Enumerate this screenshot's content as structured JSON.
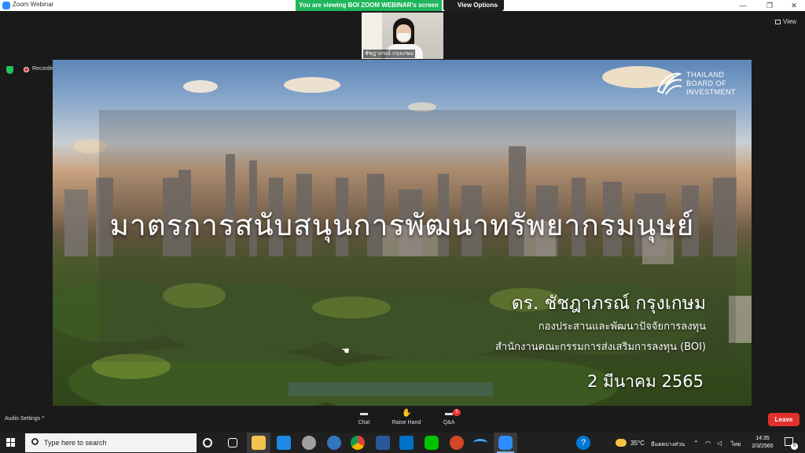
{
  "window": {
    "title": "Zoom Webinar",
    "min": "—",
    "max": "❐",
    "close": "✕"
  },
  "banner": {
    "text": "You are viewing BOI ZOOM WEBINAR's screen"
  },
  "view_options": {
    "label": "View Options",
    "chevron": "⌄"
  },
  "view_button": {
    "label": "View"
  },
  "recording": {
    "label": "Recording"
  },
  "participant": {
    "name": "ชัชฎาภรณ์ กรุงเกษม"
  },
  "slide": {
    "title": "มาตรการสนับสนุนการพัฒนาทรัพยากรมนุษย์",
    "presenter": "ดร. ชัชฎาภรณ์ กรุงเกษม",
    "org_line1": "กองประสานและพัฒนาปัจจัยการลงทุน",
    "org_line2": "สำนักงานคณะกรรมการส่งเสริมการลงทุน (BOI)",
    "date": "2 มีนาคม 2565",
    "logo_line1": "THAILAND",
    "logo_line2": "BOARD OF",
    "logo_line3": "INVESTMENT"
  },
  "toolbar": {
    "audio_settings": "Audio Settings",
    "audio_chevron": "^",
    "chat": "Chat",
    "raise_hand": "Raise Hand",
    "qa": "Q&A",
    "qa_badge": "5",
    "leave": "Leave"
  },
  "taskbar": {
    "search_placeholder": "Type here to search",
    "weather": "35°C",
    "weather_desc": "มีแดดบางส่วน",
    "language": "ไทย",
    "time": "14:35",
    "date": "2/3/2565",
    "notifications": "5",
    "tray_chevron": "⌃",
    "help_icon": "?"
  },
  "colors": {
    "accent": "#2d8cff",
    "banner": "#1fb65c",
    "leave": "#e0322b"
  }
}
